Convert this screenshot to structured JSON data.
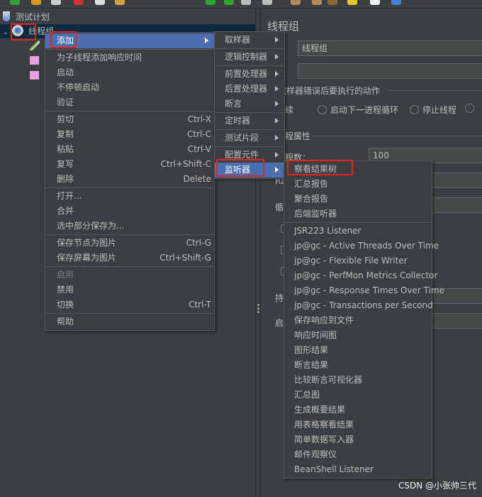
{
  "tree": {
    "test_plan": "测试计划",
    "thread_group": "线程组"
  },
  "context_menu": {
    "items": [
      {
        "label": "添加",
        "submenu": true,
        "highlighted": true
      },
      {
        "sep": true
      },
      {
        "label": "为子线程添加响应时间"
      },
      {
        "label": "启动"
      },
      {
        "label": "不停顿启动"
      },
      {
        "label": "验证"
      },
      {
        "sep": true
      },
      {
        "label": "剪切",
        "shortcut": "Ctrl-X"
      },
      {
        "label": "复制",
        "shortcut": "Ctrl-C"
      },
      {
        "label": "粘贴",
        "shortcut": "Ctrl-V"
      },
      {
        "label": "复写",
        "shortcut": "Ctrl+Shift-C"
      },
      {
        "label": "删除",
        "shortcut": "Delete"
      },
      {
        "sep": true
      },
      {
        "label": "打开..."
      },
      {
        "label": "合并"
      },
      {
        "label": "选中部分保存为..."
      },
      {
        "sep": true
      },
      {
        "label": "保存节点为图片",
        "shortcut": "Ctrl-G"
      },
      {
        "label": "保存屏幕为图片",
        "shortcut": "Ctrl+Shift-G"
      },
      {
        "sep": true
      },
      {
        "label": "启用",
        "disabled": true
      },
      {
        "label": "禁用"
      },
      {
        "label": "切换",
        "shortcut": "Ctrl-T"
      },
      {
        "sep": true
      },
      {
        "label": "帮助"
      }
    ]
  },
  "add_submenu": {
    "items": [
      {
        "label": "取样器"
      },
      {
        "sep": true
      },
      {
        "label": "逻辑控制器"
      },
      {
        "sep": true
      },
      {
        "label": "前置处理器"
      },
      {
        "label": "后置处理器"
      },
      {
        "label": "断言"
      },
      {
        "sep": true
      },
      {
        "label": "定时器"
      },
      {
        "sep": true
      },
      {
        "label": "测试片段"
      },
      {
        "sep": true
      },
      {
        "label": "配置元件"
      },
      {
        "label": "监听器",
        "highlighted": true
      }
    ]
  },
  "listener_submenu": {
    "items": [
      {
        "label": "察看结果树"
      },
      {
        "label": "汇总报告"
      },
      {
        "label": "聚合报告"
      },
      {
        "label": "后端监听器"
      },
      {
        "sep": true
      },
      {
        "label": "JSR223 Listener"
      },
      {
        "label": "jp@gc - Active Threads Over Time"
      },
      {
        "label": "jp@gc - Flexible File Writer"
      },
      {
        "label": "jp@gc - PerfMon Metrics Collector"
      },
      {
        "label": "jp@gc - Response Times Over Time"
      },
      {
        "label": "jp@gc - Transactions per Second"
      },
      {
        "label": "保存响应到文件"
      },
      {
        "label": "响应时间图"
      },
      {
        "label": "图形结果"
      },
      {
        "label": "断言结果"
      },
      {
        "label": "比较断言可视化器"
      },
      {
        "label": "汇总图"
      },
      {
        "label": "生成概要结果"
      },
      {
        "label": "用表格察看结果"
      },
      {
        "label": "简单数据写入器"
      },
      {
        "label": "邮件观察仪"
      },
      {
        "label": "BeanShell Listener"
      }
    ]
  },
  "panel": {
    "title": "线程组",
    "name_label_suffix": ":",
    "name_value": "线程组",
    "comment_label_suffix": ":",
    "error_action_title": "取样器错误后要执行的动作",
    "radio_options": [
      "继续",
      "启动下一进程循环",
      "停止线程"
    ],
    "thread_props_title": "线程属性",
    "threads_label": "线程数：",
    "threads_value": "100",
    "rampup_label": "Ra",
    "loop_label": "循",
    "duration_label": "持",
    "startup_label": "启"
  },
  "watermark": "CSDN @小张帅三代",
  "colors": {
    "highlight": "#4b6eaf",
    "annotation": "#e8231f",
    "background": "#3c3f41",
    "selected_row": "#0d293e"
  }
}
